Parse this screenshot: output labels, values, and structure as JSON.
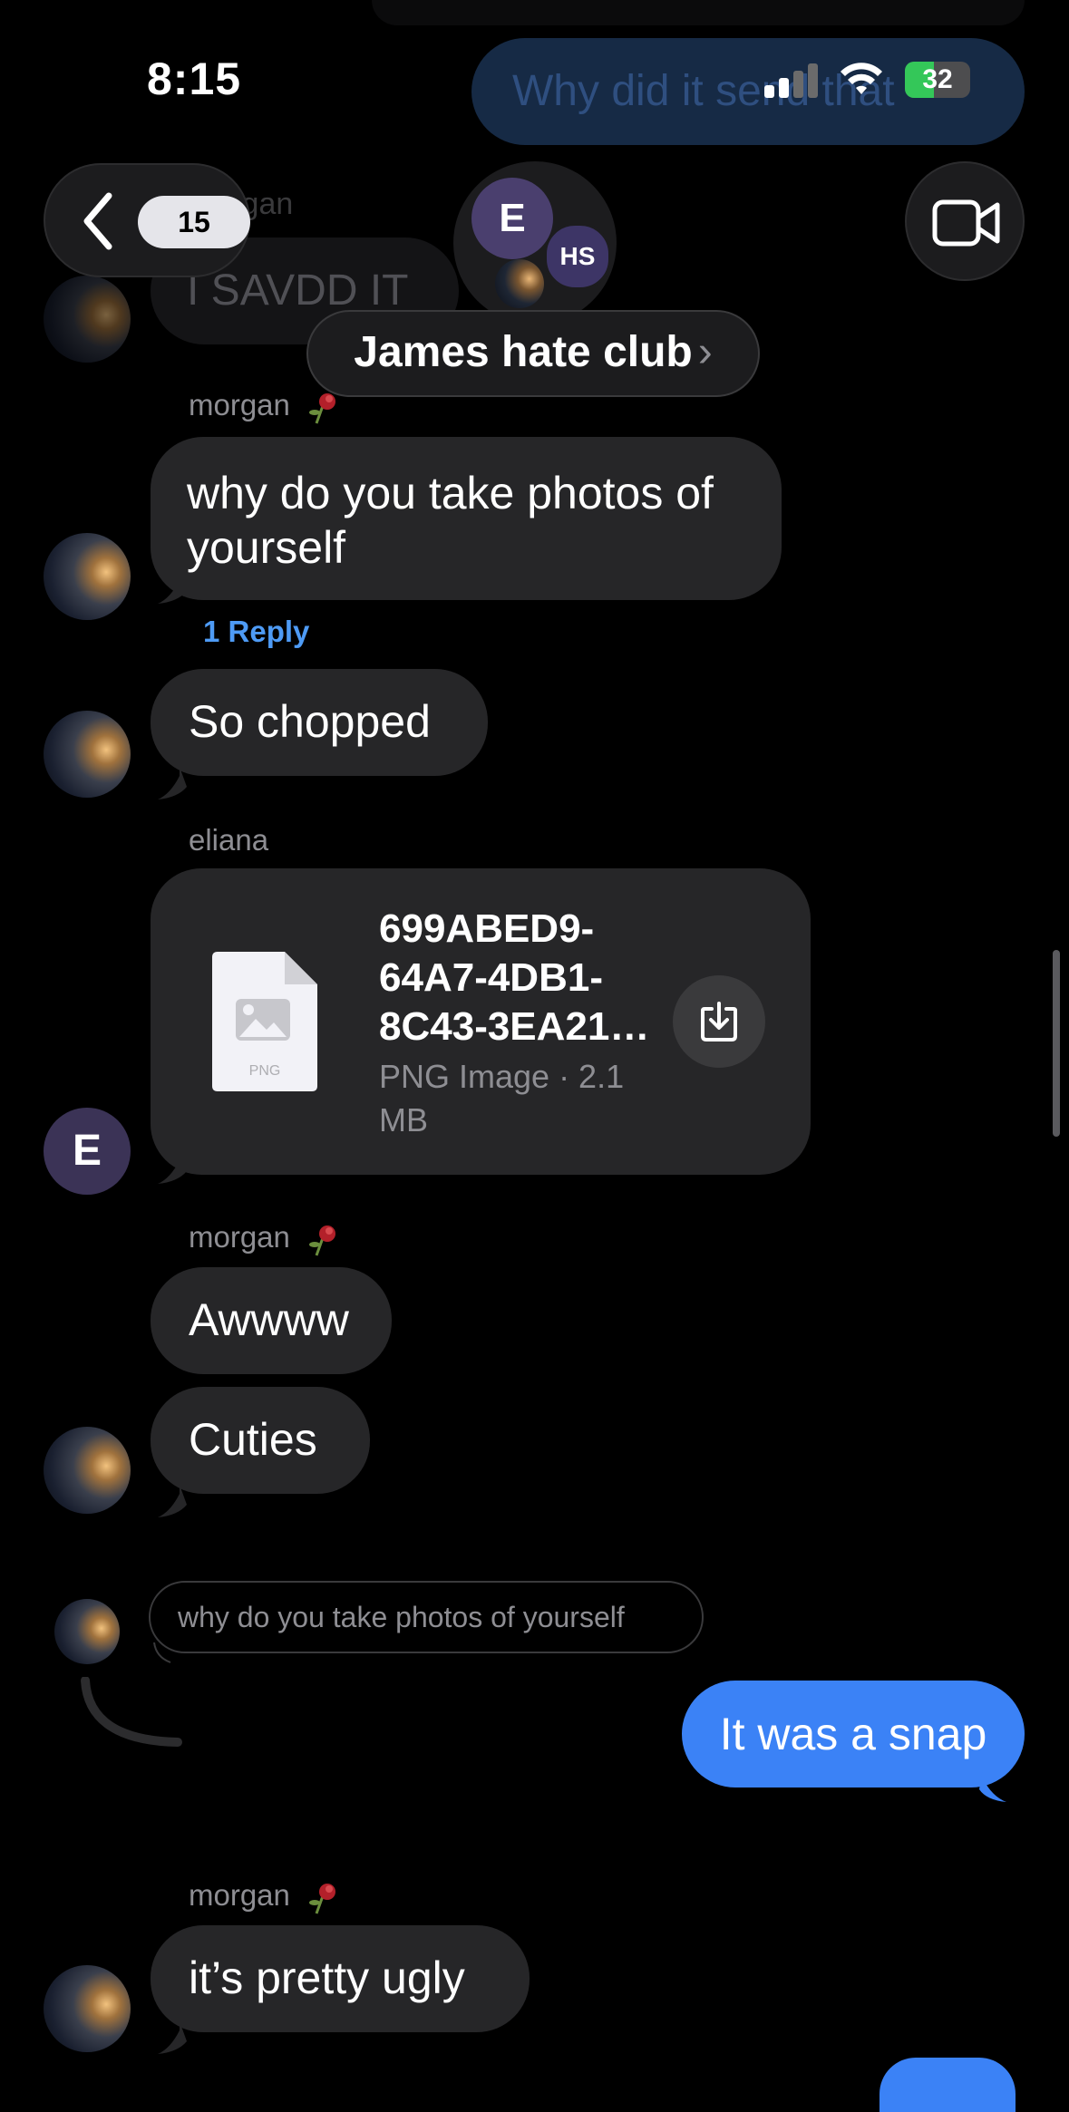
{
  "status_bar": {
    "time": "8:15",
    "battery_level": "32"
  },
  "header": {
    "unread_count": "15",
    "group_name": "James hate club",
    "group_name_caret": "›",
    "avatars": {
      "primary_initial": "E",
      "secondary_initials": "HS"
    }
  },
  "background_faded": {
    "sent_text": "Why did it send that",
    "sender_partial": "morgan",
    "bubble_text": "I SAVDD IT"
  },
  "messages": [
    {
      "sender": "morgan",
      "text": "why do you take photos of yourself",
      "reply_label": "1 Reply"
    },
    {
      "text": "So chopped"
    },
    {
      "sender": "eliana",
      "avatar_initial": "E",
      "file": {
        "name": "699ABED9-64A7-4DB1-8C43-3EA21…",
        "type_label": "PNG",
        "meta": "PNG Image · 2.1 MB"
      }
    },
    {
      "sender": "morgan",
      "texts": [
        "Awwww",
        "Cuties"
      ]
    },
    {
      "quoted": "why do you take photos of yourself",
      "sent_reply": "It was a snap"
    },
    {
      "sender": "morgan",
      "text": "it’s pretty ugly"
    }
  ],
  "colors": {
    "background": "#000000",
    "bubble_received": "#262628",
    "bubble_sent": "#3b82f6",
    "link": "#4e9bf5",
    "secondary_text": "#8e8e93"
  }
}
